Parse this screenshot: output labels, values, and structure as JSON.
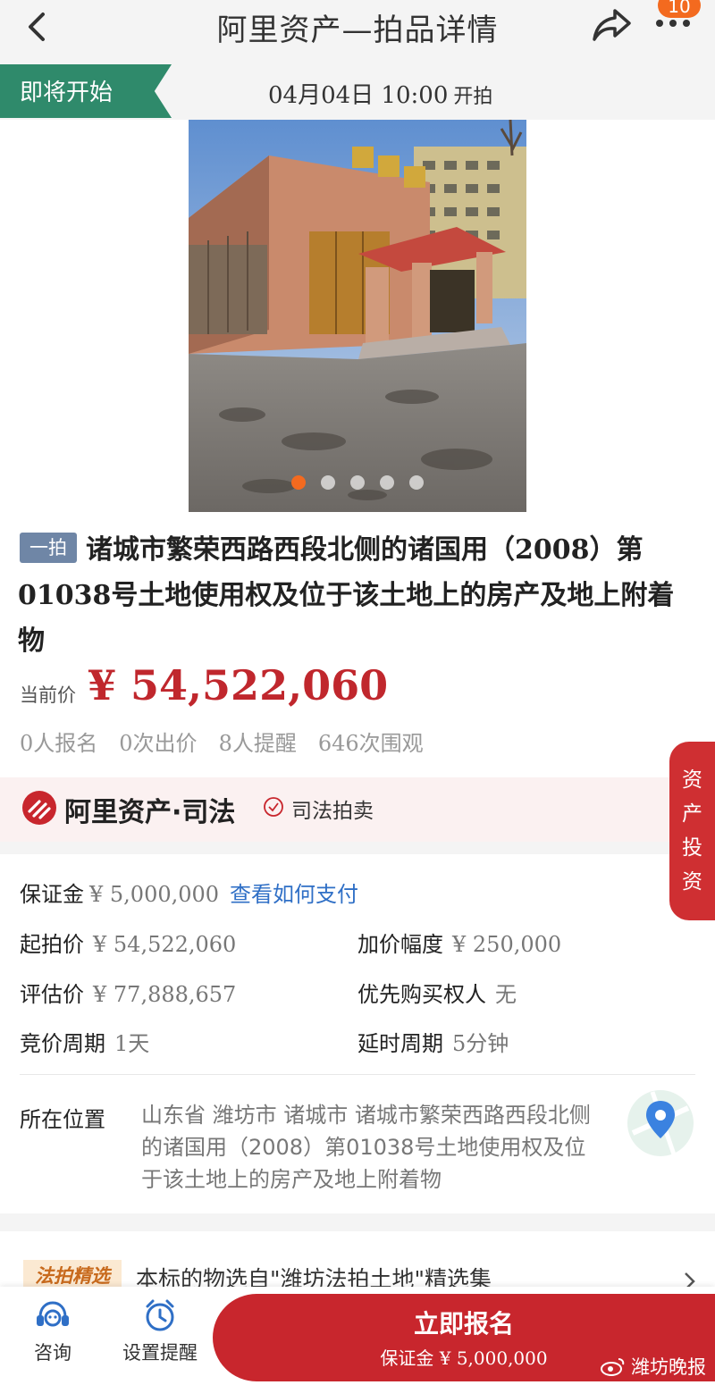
{
  "header": {
    "title": "阿里资产—拍品详情",
    "badge": "10",
    "icons": [
      "back-icon",
      "share-icon",
      "more-icon"
    ]
  },
  "status": {
    "tag": "即将开始",
    "start_time": "04月04日 10:00",
    "start_suffix": "开拍"
  },
  "gallery": {
    "total": 5,
    "active_index": 0
  },
  "item": {
    "round_tag": "一拍",
    "title": "诸城市繁荣西路西段北侧的诸国用（2008）第01038号土地使用权及位于该土地上的房产及地上附着物",
    "price_label": "当前价",
    "price": "¥ 54,522,060",
    "stats": {
      "signups": "0人报名",
      "bids": "0次出价",
      "reminders": "8人提醒",
      "views": "646次围观"
    }
  },
  "brand": {
    "name": "阿里资产·司法",
    "service": "司法拍卖"
  },
  "info": {
    "deposit_label": "保证金",
    "deposit_value": "¥ 5,000,000",
    "deposit_link": "查看如何支付",
    "start_price_label": "起拍价",
    "start_price_value": "¥ 54,522,060",
    "increment_label": "加价幅度",
    "increment_value": "¥ 250,000",
    "appraisal_label": "评估价",
    "appraisal_value": "¥ 77,888,657",
    "priority_label": "优先购买权人",
    "priority_value": "无",
    "cycle_label": "竞价周期",
    "cycle_value": "1天",
    "delay_label": "延时周期",
    "delay_value": "5分钟",
    "location_label": "所在位置",
    "location_value": "山东省 潍坊市 诸城市 诸城市繁荣西路西段北侧的诸国用（2008）第01038号土地使用权及位于该土地上的房产及地上附着物"
  },
  "promo": {
    "tag": "法拍精选",
    "text": "本标的物选自\"潍坊法拍土地\"精选集"
  },
  "side_tab": {
    "label": [
      "资",
      "产",
      "投",
      "资"
    ]
  },
  "bottom_bar": {
    "consult": "咨询",
    "reminder": "设置提醒",
    "cta_label": "立即报名",
    "cta_sub": "保证金 ¥ 5,000,000",
    "watermark": "潍坊晚报"
  },
  "colors": {
    "accent_red": "#c8262d",
    "status_green": "#2f8a6b",
    "link_blue": "#2f6fc6",
    "dot_active": "#f36a1f"
  }
}
